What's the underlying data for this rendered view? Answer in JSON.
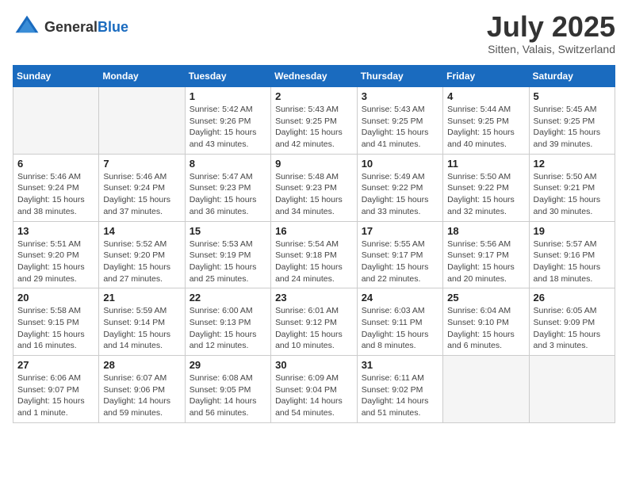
{
  "header": {
    "logo_general": "General",
    "logo_blue": "Blue",
    "month_year": "July 2025",
    "location": "Sitten, Valais, Switzerland"
  },
  "weekdays": [
    "Sunday",
    "Monday",
    "Tuesday",
    "Wednesday",
    "Thursday",
    "Friday",
    "Saturday"
  ],
  "weeks": [
    [
      {
        "day": "",
        "info": ""
      },
      {
        "day": "",
        "info": ""
      },
      {
        "day": "1",
        "info": "Sunrise: 5:42 AM\nSunset: 9:26 PM\nDaylight: 15 hours\nand 43 minutes."
      },
      {
        "day": "2",
        "info": "Sunrise: 5:43 AM\nSunset: 9:25 PM\nDaylight: 15 hours\nand 42 minutes."
      },
      {
        "day": "3",
        "info": "Sunrise: 5:43 AM\nSunset: 9:25 PM\nDaylight: 15 hours\nand 41 minutes."
      },
      {
        "day": "4",
        "info": "Sunrise: 5:44 AM\nSunset: 9:25 PM\nDaylight: 15 hours\nand 40 minutes."
      },
      {
        "day": "5",
        "info": "Sunrise: 5:45 AM\nSunset: 9:25 PM\nDaylight: 15 hours\nand 39 minutes."
      }
    ],
    [
      {
        "day": "6",
        "info": "Sunrise: 5:46 AM\nSunset: 9:24 PM\nDaylight: 15 hours\nand 38 minutes."
      },
      {
        "day": "7",
        "info": "Sunrise: 5:46 AM\nSunset: 9:24 PM\nDaylight: 15 hours\nand 37 minutes."
      },
      {
        "day": "8",
        "info": "Sunrise: 5:47 AM\nSunset: 9:23 PM\nDaylight: 15 hours\nand 36 minutes."
      },
      {
        "day": "9",
        "info": "Sunrise: 5:48 AM\nSunset: 9:23 PM\nDaylight: 15 hours\nand 34 minutes."
      },
      {
        "day": "10",
        "info": "Sunrise: 5:49 AM\nSunset: 9:22 PM\nDaylight: 15 hours\nand 33 minutes."
      },
      {
        "day": "11",
        "info": "Sunrise: 5:50 AM\nSunset: 9:22 PM\nDaylight: 15 hours\nand 32 minutes."
      },
      {
        "day": "12",
        "info": "Sunrise: 5:50 AM\nSunset: 9:21 PM\nDaylight: 15 hours\nand 30 minutes."
      }
    ],
    [
      {
        "day": "13",
        "info": "Sunrise: 5:51 AM\nSunset: 9:20 PM\nDaylight: 15 hours\nand 29 minutes."
      },
      {
        "day": "14",
        "info": "Sunrise: 5:52 AM\nSunset: 9:20 PM\nDaylight: 15 hours\nand 27 minutes."
      },
      {
        "day": "15",
        "info": "Sunrise: 5:53 AM\nSunset: 9:19 PM\nDaylight: 15 hours\nand 25 minutes."
      },
      {
        "day": "16",
        "info": "Sunrise: 5:54 AM\nSunset: 9:18 PM\nDaylight: 15 hours\nand 24 minutes."
      },
      {
        "day": "17",
        "info": "Sunrise: 5:55 AM\nSunset: 9:17 PM\nDaylight: 15 hours\nand 22 minutes."
      },
      {
        "day": "18",
        "info": "Sunrise: 5:56 AM\nSunset: 9:17 PM\nDaylight: 15 hours\nand 20 minutes."
      },
      {
        "day": "19",
        "info": "Sunrise: 5:57 AM\nSunset: 9:16 PM\nDaylight: 15 hours\nand 18 minutes."
      }
    ],
    [
      {
        "day": "20",
        "info": "Sunrise: 5:58 AM\nSunset: 9:15 PM\nDaylight: 15 hours\nand 16 minutes."
      },
      {
        "day": "21",
        "info": "Sunrise: 5:59 AM\nSunset: 9:14 PM\nDaylight: 15 hours\nand 14 minutes."
      },
      {
        "day": "22",
        "info": "Sunrise: 6:00 AM\nSunset: 9:13 PM\nDaylight: 15 hours\nand 12 minutes."
      },
      {
        "day": "23",
        "info": "Sunrise: 6:01 AM\nSunset: 9:12 PM\nDaylight: 15 hours\nand 10 minutes."
      },
      {
        "day": "24",
        "info": "Sunrise: 6:03 AM\nSunset: 9:11 PM\nDaylight: 15 hours\nand 8 minutes."
      },
      {
        "day": "25",
        "info": "Sunrise: 6:04 AM\nSunset: 9:10 PM\nDaylight: 15 hours\nand 6 minutes."
      },
      {
        "day": "26",
        "info": "Sunrise: 6:05 AM\nSunset: 9:09 PM\nDaylight: 15 hours\nand 3 minutes."
      }
    ],
    [
      {
        "day": "27",
        "info": "Sunrise: 6:06 AM\nSunset: 9:07 PM\nDaylight: 15 hours\nand 1 minute."
      },
      {
        "day": "28",
        "info": "Sunrise: 6:07 AM\nSunset: 9:06 PM\nDaylight: 14 hours\nand 59 minutes."
      },
      {
        "day": "29",
        "info": "Sunrise: 6:08 AM\nSunset: 9:05 PM\nDaylight: 14 hours\nand 56 minutes."
      },
      {
        "day": "30",
        "info": "Sunrise: 6:09 AM\nSunset: 9:04 PM\nDaylight: 14 hours\nand 54 minutes."
      },
      {
        "day": "31",
        "info": "Sunrise: 6:11 AM\nSunset: 9:02 PM\nDaylight: 14 hours\nand 51 minutes."
      },
      {
        "day": "",
        "info": ""
      },
      {
        "day": "",
        "info": ""
      }
    ]
  ]
}
